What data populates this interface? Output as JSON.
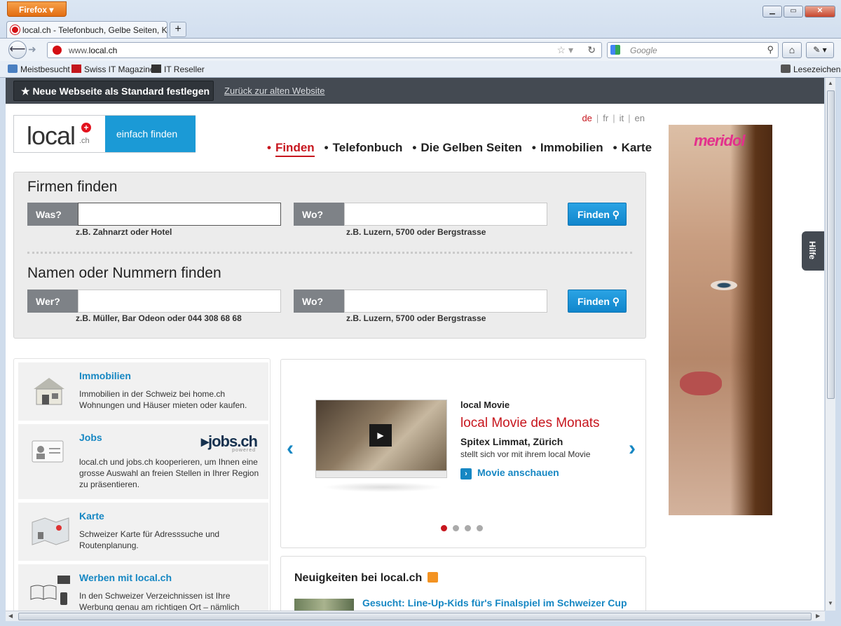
{
  "browser": {
    "menu_button": "Firefox ▾",
    "tab_title": "local.ch - Telefonbuch, Gelbe Seiten, Kar...",
    "url_prefix": "www.",
    "url_domain": "local.ch",
    "search_placeholder": "Google",
    "bookmarks": [
      "Meistbesucht",
      "Swiss IT Magazine",
      "IT Reseller"
    ],
    "bookmarks_menu": "Lesezeichen"
  },
  "page": {
    "topbar": {
      "default_button": "★ Neue Webseite als Standard festlegen",
      "old_site_link": "Zurück zur alten Website"
    },
    "logo": {
      "text": "local",
      "suffix": ".ch",
      "tagline": "einfach finden"
    },
    "languages": [
      "de",
      "fr",
      "it",
      "en"
    ],
    "nav": [
      "Finden",
      "Telefonbuch",
      "Die Gelben Seiten",
      "Immobilien",
      "Karte"
    ],
    "firms": {
      "title": "Firmen finden",
      "what_label": "Was?",
      "what_hint": "z.B. Zahnarzt oder Hotel",
      "where_label": "Wo?",
      "where_hint": "z.B. Luzern, 5700 oder Bergstrasse",
      "button": "Finden"
    },
    "names": {
      "title": "Namen oder Nummern finden",
      "who_label": "Wer?",
      "who_hint": "z.B. Müller, Bar Odeon oder 044 308 68 68",
      "where_label": "Wo?",
      "where_hint": "z.B. Luzern, 5700 oder Bergstrasse",
      "button": "Finden"
    },
    "cards": [
      {
        "title": "Immobilien",
        "desc": "Immobilien in der Schweiz bei home.ch Wohnungen und Häuser mieten oder kaufen."
      },
      {
        "title": "Jobs",
        "desc": "local.ch und jobs.ch kooperieren, um Ihnen eine grosse Auswahl an freien Stellen in Ihrer Region zu präsentieren.",
        "partner_logo": "jobs.ch",
        "partner_sub": "powered"
      },
      {
        "title": "Karte",
        "desc": "Schweizer Karte für Adresssuche und Routenplanung."
      },
      {
        "title": "Werben mit local.ch",
        "desc": "In den Schweizer Verzeichnissen ist Ihre Werbung genau am richtigen Ort – nämlich"
      }
    ],
    "movie": {
      "label": "local Movie",
      "headline": "local Movie des Monats",
      "subject": "Spitex Limmat, Zürich",
      "desc": "stellt sich vor mit ihrem local Movie",
      "link": "Movie anschauen",
      "slides": 4,
      "active_slide": 1
    },
    "news": {
      "title": "Neuigkeiten bei local.ch",
      "first_item": "Gesucht: Line-Up-Kids für's Finalspiel im Schweizer Cup"
    },
    "ad": {
      "brand": "meridol"
    },
    "help_tab": "Hilfe"
  }
}
